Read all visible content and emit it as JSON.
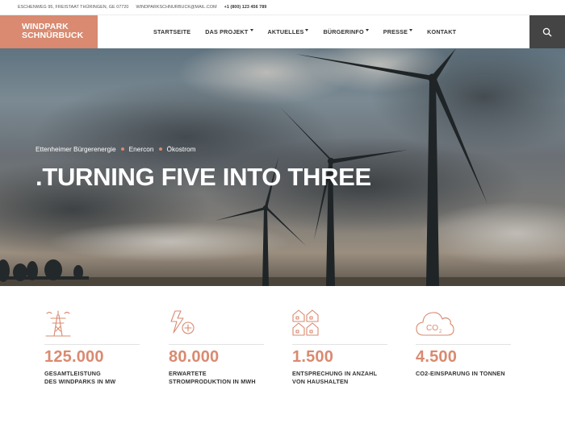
{
  "topbar": {
    "address": "ESCHENWEG 95, FREISTAAT THÜRINGEN, GE 07720",
    "email": "WINDPARKSCHNURBUCK@MAIL.COM",
    "phone": "+1 (800) 123 456 789"
  },
  "logo": {
    "line1": "WINDPARK",
    "line2": "SCHNÜRBUCK"
  },
  "nav": {
    "items": [
      {
        "label": "STARTSEITE",
        "has_dropdown": false
      },
      {
        "label": "DAS PROJEKT",
        "has_dropdown": true
      },
      {
        "label": "AKTUELLES",
        "has_dropdown": true
      },
      {
        "label": "BÜRGERINFO",
        "has_dropdown": true
      },
      {
        "label": "PRESSE",
        "has_dropdown": true
      },
      {
        "label": "KONTAKT",
        "has_dropdown": false
      }
    ],
    "search_icon": "search-icon"
  },
  "hero": {
    "tags": [
      "Ettenheimer Bürgerenergie",
      "Enercon",
      "Ökostrom"
    ],
    "title": ".TURNING FIVE INTO THREE"
  },
  "stats": [
    {
      "icon": "power-tower-icon",
      "value": "125.000",
      "label_line1": "GESAMTLEISTUNG",
      "label_line2": "DES WINDPARKS IN MW"
    },
    {
      "icon": "power-plus-icon",
      "value": "80.000",
      "label_line1": "ERWARTETE",
      "label_line2": "STROMPRODUKTION IN MWH"
    },
    {
      "icon": "houses-icon",
      "value": "1.500",
      "label_line1": "ENTSPRECHUNG IN ANZAHL",
      "label_line2": "VON HAUSHALTEN"
    },
    {
      "icon": "co2-cloud-icon",
      "value": "4.500",
      "label_line1": "CO2-EINSPARUNG IN TONNEN",
      "label_line2": ""
    }
  ],
  "colors": {
    "accent": "#d98a70",
    "dark": "#444444"
  }
}
